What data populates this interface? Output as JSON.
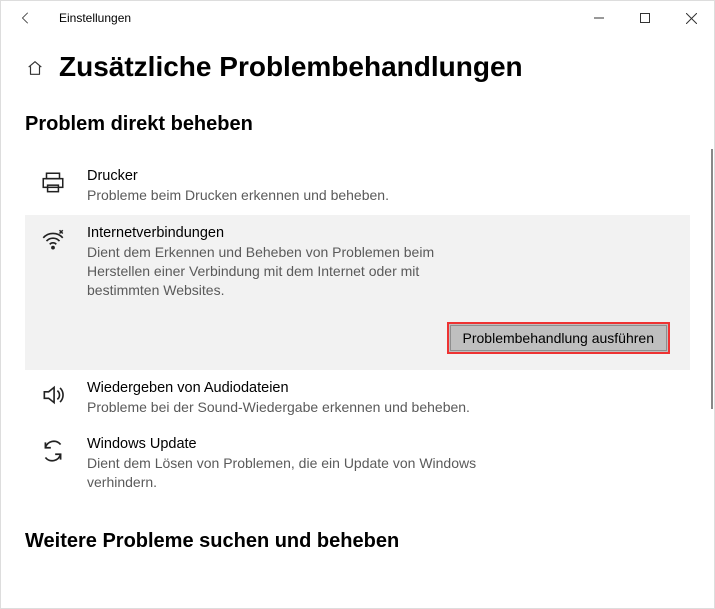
{
  "window": {
    "title": "Einstellungen"
  },
  "page": {
    "title": "Zusätzliche Problembehandlungen"
  },
  "sections": {
    "direct": "Problem direkt beheben",
    "more": "Weitere Probleme suchen und beheben"
  },
  "run_button": "Problembehandlung ausführen",
  "items": [
    {
      "title": "Drucker",
      "desc": "Probleme beim Drucken erkennen und beheben."
    },
    {
      "title": "Internetverbindungen",
      "desc": "Dient dem Erkennen und Beheben von Problemen beim Herstellen einer Verbindung mit dem Internet oder mit bestimmten Websites."
    },
    {
      "title": "Wiedergeben von Audiodateien",
      "desc": "Probleme bei der Sound-Wiedergabe erkennen und beheben."
    },
    {
      "title": "Windows Update",
      "desc": "Dient dem Lösen von Problemen, die ein Update von Windows verhindern."
    }
  ]
}
